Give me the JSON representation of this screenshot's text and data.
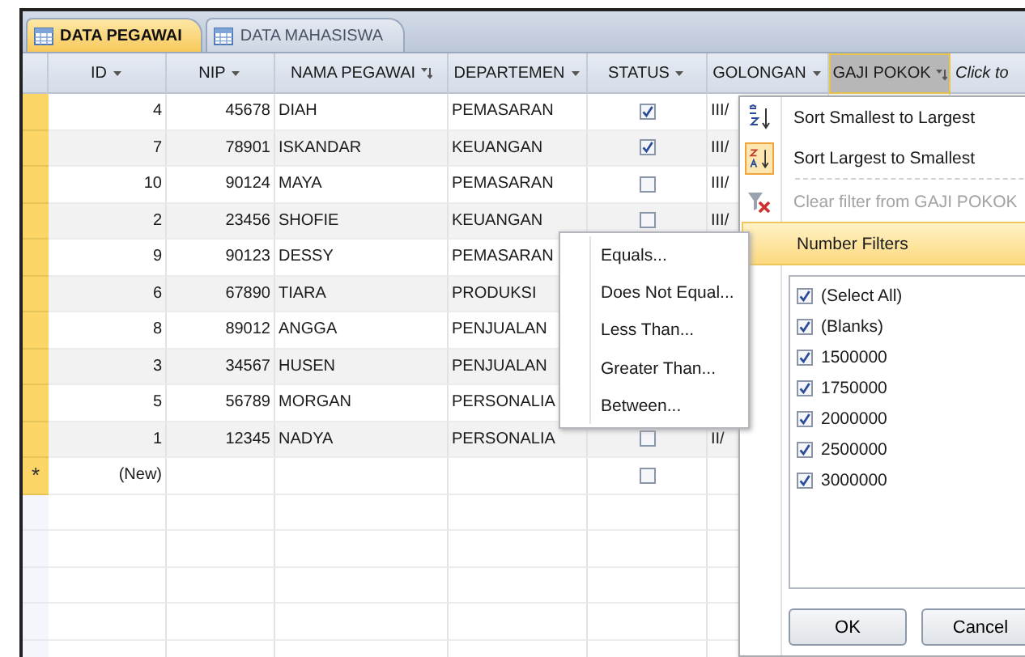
{
  "tabs": [
    {
      "label": "DATA PEGAWAI",
      "selected": true
    },
    {
      "label": "DATA MAHASISWA",
      "selected": false
    }
  ],
  "table": {
    "columns": [
      {
        "label": "ID",
        "kind": "field",
        "filtered": false,
        "selected": false
      },
      {
        "label": "NIP",
        "kind": "field",
        "filtered": false,
        "selected": false
      },
      {
        "label": "NAMA PEGAWAI",
        "kind": "field",
        "filtered": true,
        "selected": false
      },
      {
        "label": "DEPARTEMEN",
        "kind": "field",
        "filtered": false,
        "selected": false
      },
      {
        "label": "STATUS",
        "kind": "field",
        "filtered": false,
        "selected": false
      },
      {
        "label": "GOLONGAN",
        "kind": "field",
        "filtered": false,
        "selected": false
      },
      {
        "label": "GAJI POKOK",
        "kind": "field",
        "filtered": true,
        "selected": true
      },
      {
        "label": "Click to",
        "kind": "add"
      }
    ],
    "rows": [
      {
        "id": "4",
        "nip": "45678",
        "nama": "DIAH",
        "departemen": "PEMASARAN",
        "status_checked": true,
        "golongan": "III/"
      },
      {
        "id": "7",
        "nip": "78901",
        "nama": "ISKANDAR",
        "departemen": "KEUANGAN",
        "status_checked": true,
        "golongan": "III/"
      },
      {
        "id": "10",
        "nip": "90124",
        "nama": "MAYA",
        "departemen": "PEMASARAN",
        "status_checked": false,
        "golongan": "III/"
      },
      {
        "id": "2",
        "nip": "23456",
        "nama": "SHOFIE",
        "departemen": "KEUANGAN",
        "status_checked": false,
        "golongan": "III/"
      },
      {
        "id": "9",
        "nip": "90123",
        "nama": "DESSY",
        "departemen": "PEMASARAN"
      },
      {
        "id": "6",
        "nip": "67890",
        "nama": "TIARA",
        "departemen": "PRODUKSI"
      },
      {
        "id": "8",
        "nip": "89012",
        "nama": "ANGGA",
        "departemen": "PENJUALAN"
      },
      {
        "id": "3",
        "nip": "34567",
        "nama": "HUSEN",
        "departemen": "PENJUALAN"
      },
      {
        "id": "5",
        "nip": "56789",
        "nama": "MORGAN",
        "departemen": "PERSONALIA"
      },
      {
        "id": "1",
        "nip": "12345",
        "nama": "NADYA",
        "departemen": "PERSONALIA",
        "status_checked": false,
        "golongan": "II/"
      }
    ],
    "new_row": {
      "marker": "*",
      "id": "(New)",
      "status_checked": false
    }
  },
  "filter_menu": {
    "items": [
      {
        "label": "Sort Smallest to Largest",
        "kind": "sort_asc",
        "active": false,
        "disabled": false,
        "selected": false
      },
      {
        "label": "Sort Largest to Smallest",
        "kind": "sort_desc",
        "active": true,
        "disabled": false,
        "selected": false
      },
      {
        "label": "Clear filter from GAJI POKOK",
        "kind": "clear",
        "disabled": true,
        "selected": false
      },
      {
        "label": "Number Filters",
        "kind": "submenu",
        "disabled": false,
        "selected": true
      }
    ],
    "values": [
      {
        "label": "(Select All)",
        "checked": true
      },
      {
        "label": "(Blanks)",
        "checked": true
      },
      {
        "label": "1500000",
        "checked": true
      },
      {
        "label": "1750000",
        "checked": true
      },
      {
        "label": "2000000",
        "checked": true
      },
      {
        "label": "2500000",
        "checked": true
      },
      {
        "label": "3000000",
        "checked": true
      }
    ],
    "buttons": [
      "OK",
      "Cancel"
    ]
  },
  "number_filters_menu": {
    "items": [
      "Equals...",
      "Does Not Equal...",
      "Less Than...",
      "Greater Than...",
      "Between..."
    ]
  }
}
